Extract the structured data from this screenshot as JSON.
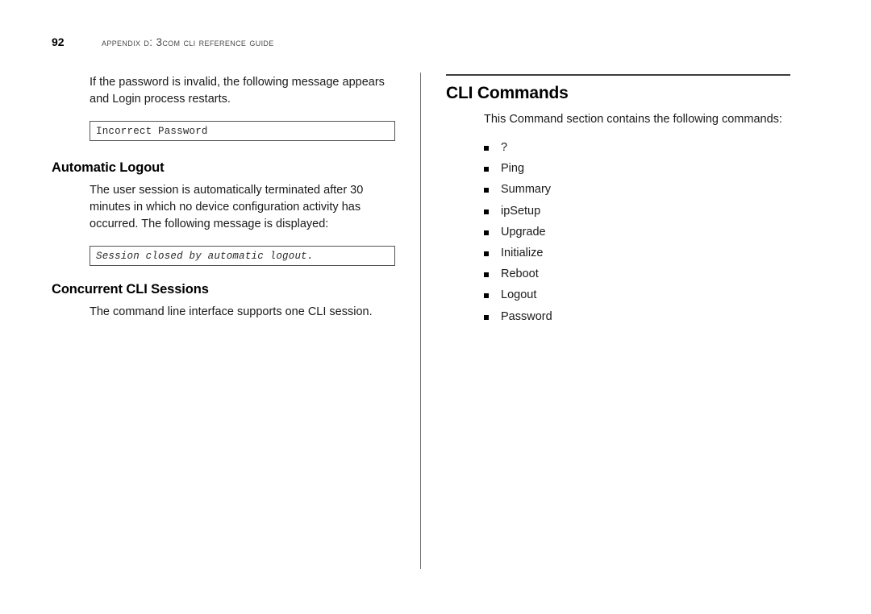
{
  "header": {
    "page_number": "92",
    "title": "Appendix D: 3Com CLI Reference Guide"
  },
  "left_column": {
    "intro_paragraph": "If the password is invalid, the following message appears and Login process restarts.",
    "message_box_1": "Incorrect Password",
    "section_automatic_logout": {
      "heading": "Automatic Logout",
      "paragraph": "The user session is automatically terminated after 30 minutes in which no device configuration activity has occurred. The following message is displayed:",
      "message_box": "Session closed by automatic logout."
    },
    "section_concurrent_sessions": {
      "heading": "Concurrent CLI Sessions",
      "paragraph": "The command line interface supports one CLI session."
    }
  },
  "right_column": {
    "heading": "CLI Commands",
    "intro_paragraph": "This Command section contains the following commands:",
    "command_list": [
      "?",
      "Ping",
      "Summary",
      "ipSetup",
      "Upgrade",
      "Initialize",
      "Reboot",
      "Logout",
      "Password"
    ]
  },
  "colors": {
    "text": "#1a1a1a",
    "heading": "#000000",
    "header_title": "#4a4a4a",
    "rule": "#3d3d3d",
    "box_border": "#555555",
    "divider": "#6f6f6f",
    "page_background": "#ffffff"
  }
}
